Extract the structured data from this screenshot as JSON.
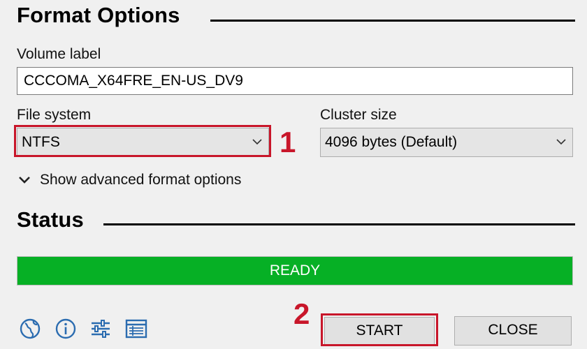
{
  "format_options": {
    "title": "Format Options",
    "volume_label": {
      "label": "Volume label",
      "value": "CCCOMA_X64FRE_EN-US_DV9"
    },
    "file_system": {
      "label": "File system",
      "value": "NTFS"
    },
    "cluster_size": {
      "label": "Cluster size",
      "value": "4096 bytes (Default)"
    },
    "advanced_toggle": "Show advanced format options"
  },
  "status": {
    "title": "Status",
    "progress_text": "READY",
    "progress_fraction": 1.0,
    "progress_color": "#06b025"
  },
  "footer": {
    "icons": [
      "globe-icon",
      "info-icon",
      "settings-sliders-icon",
      "log-icon"
    ],
    "start_label": "START",
    "close_label": "CLOSE"
  },
  "annotations": {
    "marker_1": "1",
    "marker_2": "2",
    "highlight_color": "#c8162a"
  }
}
